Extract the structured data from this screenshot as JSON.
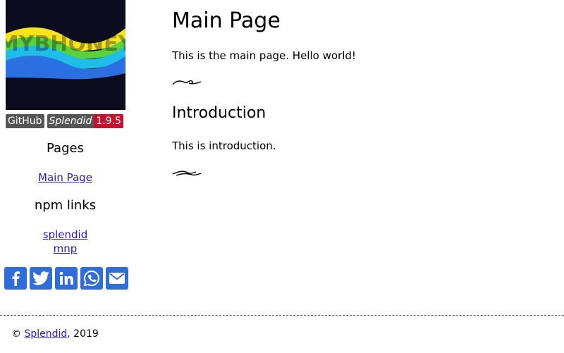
{
  "logo": {
    "text": "MYBHONEY"
  },
  "badges": {
    "github": "GitHub",
    "splendid_name": "Splendid",
    "splendid_version": "1.9.5",
    "version_color": "#c8102e"
  },
  "sidebar": {
    "pages_heading": "Pages",
    "pages_links": [
      "Main Page"
    ],
    "npm_heading": "npm links",
    "npm_links": [
      "splendid",
      "mnp"
    ]
  },
  "share": {
    "icons": [
      "facebook-icon",
      "twitter-icon",
      "linkedin-icon",
      "whatsapp-icon",
      "email-icon"
    ],
    "color": "#2f6ed9"
  },
  "main": {
    "title": "Main Page",
    "intro_text": "This is the main page. Hello world!",
    "section_title": "Introduction",
    "section_text": "This is introduction."
  },
  "footer": {
    "copyright": "©",
    "link": "Splendid",
    "year": ", 2019"
  },
  "colors": {
    "link": "#2b16c9",
    "logo_bg": "#0b0d1e"
  }
}
